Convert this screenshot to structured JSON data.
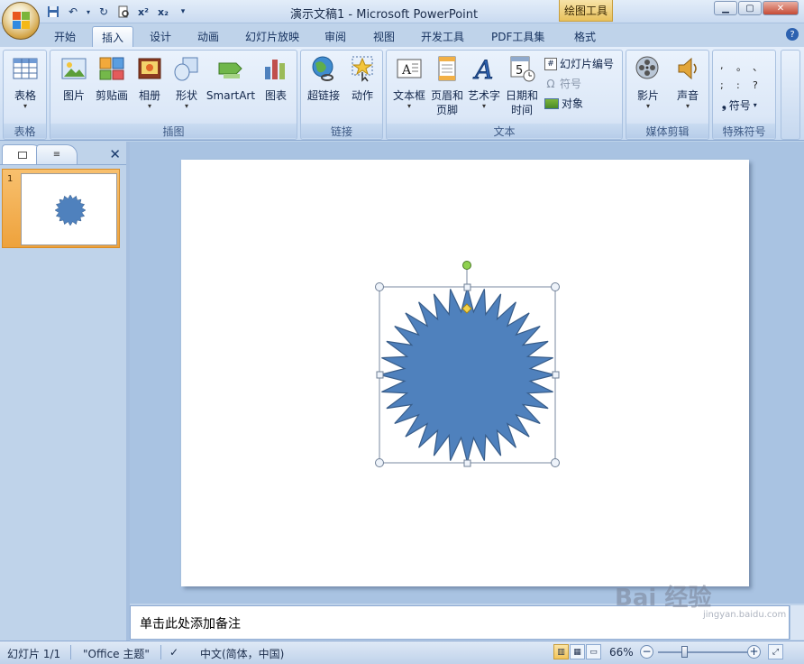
{
  "titlebar": {
    "title": "演示文稿1 - Microsoft PowerPoint",
    "context_tab": "绘图工具"
  },
  "tabs": [
    {
      "label": "开始"
    },
    {
      "label": "插入"
    },
    {
      "label": "设计"
    },
    {
      "label": "动画"
    },
    {
      "label": "幻灯片放映"
    },
    {
      "label": "审阅"
    },
    {
      "label": "视图"
    },
    {
      "label": "开发工具"
    },
    {
      "label": "PDF工具集"
    },
    {
      "label": "格式"
    }
  ],
  "active_tab": "插入",
  "ribbon": {
    "groups": {
      "table": "表格",
      "illustrations": "插图",
      "links": "链接",
      "text": "文本",
      "media": "媒体剪辑",
      "special": "特殊符号"
    },
    "buttons": {
      "table": "表格",
      "picture": "图片",
      "clipart": "剪贴画",
      "album": "相册",
      "shapes": "形状",
      "smartart": "SmartArt",
      "chart": "图表",
      "hyperlink": "超链接",
      "action": "动作",
      "textbox": "文本框",
      "header_footer_1": "页眉和",
      "header_footer_2": "页脚",
      "wordart": "艺术字",
      "datetime_1": "日期和",
      "datetime_2": "时间",
      "slide_number": "幻灯片编号",
      "symbol": "符号",
      "object": "对象",
      "movie": "影片",
      "sound": "声音",
      "special_symbol": "符号"
    },
    "special_symbols": [
      ",",
      "。",
      "、",
      ";",
      ":",
      "?"
    ]
  },
  "slides_panel": {
    "slide_number": "1"
  },
  "notes": {
    "placeholder": "单击此处添加备注"
  },
  "statusbar": {
    "slide_info": "幻灯片 1/1",
    "theme": "\"Office 主题\"",
    "language": "中文(简体，中国)",
    "zoom": "66%"
  },
  "watermark": {
    "text": "Bai 经验",
    "sub": "jingyan.baidu.com"
  },
  "colors": {
    "shape_fill": "#4f81bd",
    "shape_stroke": "#385d8a",
    "accent": "#2d62b0"
  }
}
